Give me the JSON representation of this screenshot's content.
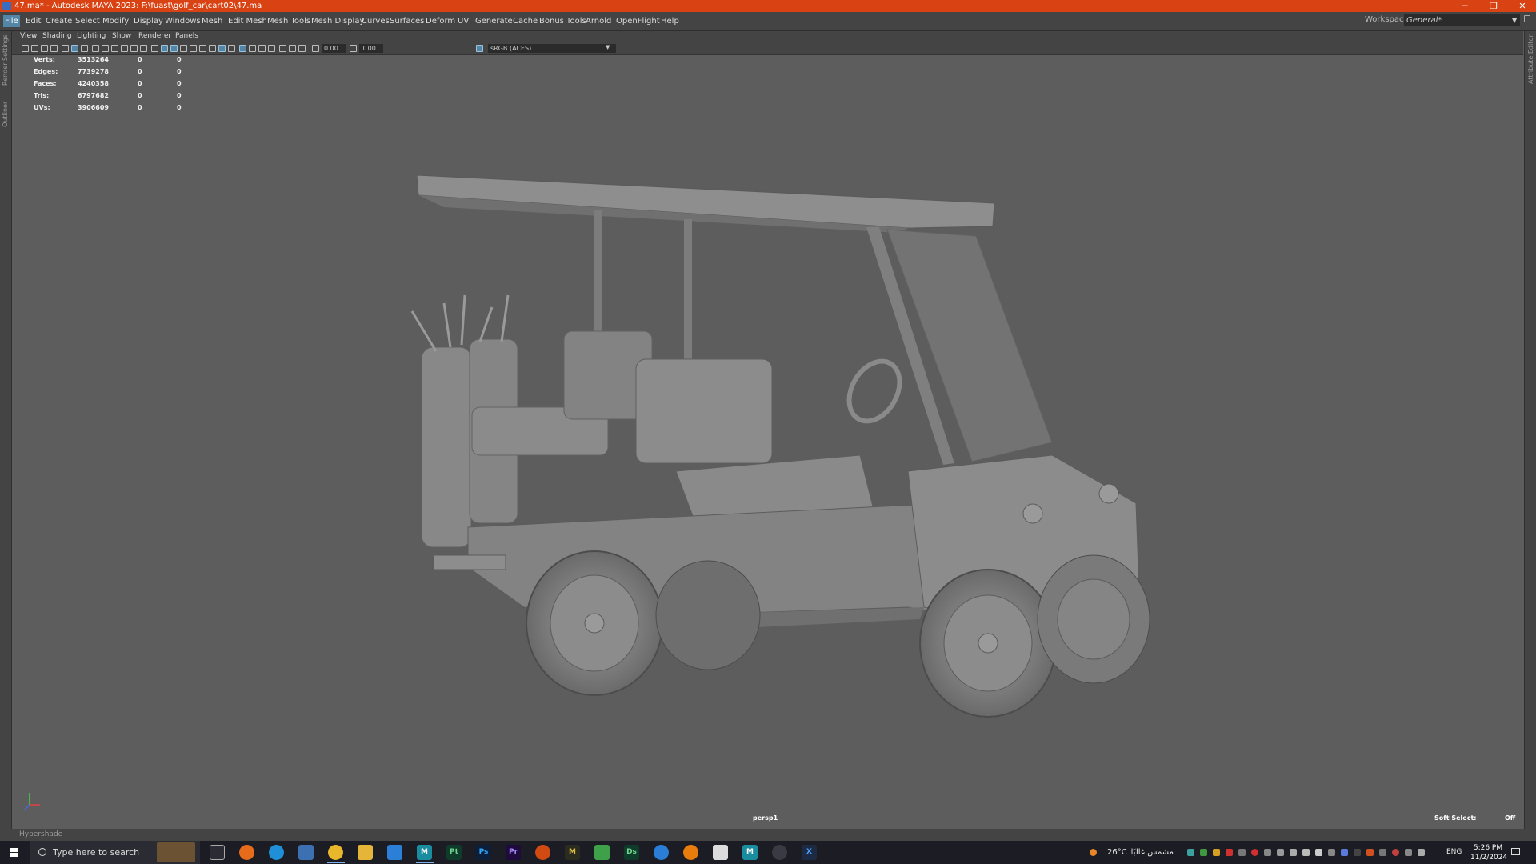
{
  "window": {
    "title": "47.ma* - Autodesk MAYA 2023: F:\\fuast\\golf_car\\cart02\\47.ma",
    "controls": [
      "minimize-icon",
      "restore-icon",
      "close-icon"
    ]
  },
  "menubar": {
    "items": [
      "File",
      "Edit",
      "Create",
      "Select",
      "Modify",
      "Display",
      "Windows",
      "Mesh",
      "Edit Mesh",
      "Mesh Tools",
      "Mesh Display",
      "Curves",
      "Surfaces",
      "Deform",
      "UV",
      "Generate",
      "Cache",
      "Bonus Tools",
      "Arnold",
      "OpenFlight",
      "Help"
    ],
    "active": "File",
    "workspace_label": "Workspace:",
    "workspace_value": "General*"
  },
  "side_tabs": {
    "left": [
      "Render Settings",
      "Outliner"
    ],
    "right": [
      "Attribute Editor"
    ]
  },
  "panel_menu": [
    "View",
    "Shading",
    "Lighting",
    "Show",
    "Renderer",
    "Panels"
  ],
  "panel_toolbar": {
    "exposure": "0.00",
    "gamma": "1.00",
    "color_space": "sRGB (ACES)"
  },
  "hud_stats": [
    {
      "label": "Verts:",
      "value": "3513264",
      "col2": "0",
      "col3": "0"
    },
    {
      "label": "Edges:",
      "value": "7739278",
      "col2": "0",
      "col3": "0"
    },
    {
      "label": "Faces:",
      "value": "4240358",
      "col2": "0",
      "col3": "0"
    },
    {
      "label": "Tris:",
      "value": "6797682",
      "col2": "0",
      "col3": "0"
    },
    {
      "label": "UVs:",
      "value": "3906609",
      "col2": "0",
      "col3": "0"
    }
  ],
  "viewport": {
    "camera": "persp1",
    "soft_select_label": "Soft Select:",
    "soft_select_value": "Off"
  },
  "hypershade_label": "Hypershade",
  "taskbar": {
    "search_placeholder": "Type here to search",
    "apps": [
      "task-view",
      "firefox",
      "edge",
      "store",
      "chrome",
      "file-explorer",
      "app-blue",
      "maya",
      "painter",
      "photoshop",
      "premiere",
      "app-orange",
      "marmoset",
      "app-green",
      "designer",
      "app-circle",
      "blender",
      "app-box",
      "maya-2",
      "app-headset",
      "app-x"
    ],
    "apps_text": [
      "",
      "",
      "",
      "",
      "",
      "",
      "",
      "M",
      "Pt",
      "Ps",
      "Pr",
      "",
      "M",
      "",
      "Ds",
      "",
      "",
      "",
      "M",
      "",
      "X"
    ],
    "weather_temp": "26°C",
    "weather_desc": "مشمس غالبًا",
    "language": "ENG",
    "time": "5:26 PM",
    "date": "11/2/2024"
  },
  "colors": {
    "titlebar": "#d94313",
    "menubar": "#444444",
    "viewport_bg": "#5d5d5d",
    "accent": "#5285a6"
  }
}
